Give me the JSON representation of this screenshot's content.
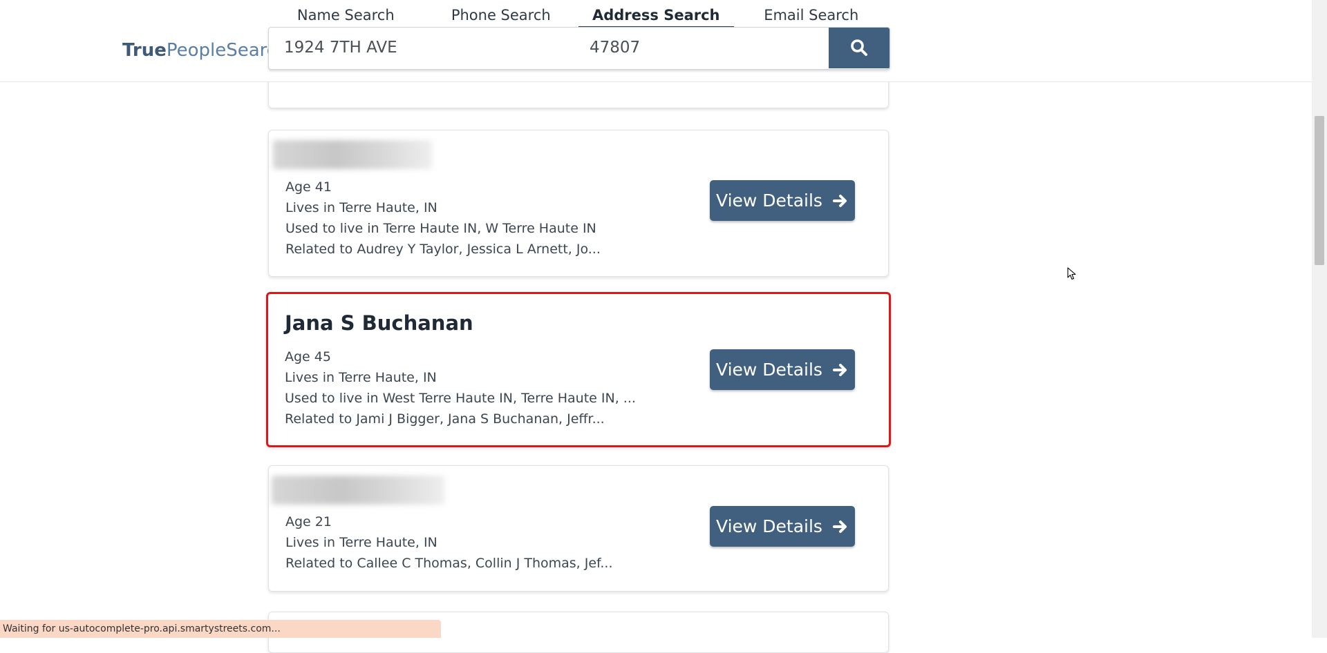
{
  "logo": {
    "bold": "True",
    "normal": "PeopleSearch"
  },
  "tabs": [
    {
      "label": "Name Search"
    },
    {
      "label": "Phone Search"
    },
    {
      "label": "Address Search"
    },
    {
      "label": "Email Search"
    }
  ],
  "search": {
    "address_value": "1924 7TH AVE",
    "zip_value": "47807",
    "button_icon": "search-icon"
  },
  "results": [
    {
      "name": "",
      "name_blurred": true,
      "age": "Age 41",
      "lives": "Lives in Terre Haute, IN",
      "used_to_live": "Used to live in Terre Haute IN, W Terre Haute IN",
      "related": "Related to Audrey Y Taylor, Jessica L Arnett, Jo...",
      "button_label": "View Details"
    },
    {
      "name": "Jana S Buchanan",
      "name_blurred": false,
      "age": "Age 45",
      "lives": "Lives in Terre Haute, IN",
      "used_to_live": "Used to live in West Terre Haute IN, Terre Haute IN, ...",
      "related": "Related to Jami J Bigger, Jana S Buchanan, Jeffr...",
      "button_label": "View Details",
      "highlight_color": "#e01515"
    },
    {
      "name": "",
      "name_blurred": true,
      "age": "Age 21",
      "lives": "Lives in Terre Haute, IN",
      "related": "Related to Callee C Thomas, Collin J Thomas, Jef...",
      "button_label": "View Details"
    }
  ],
  "status_bar": "Waiting for us-autocomplete-pro.api.smartystreets.com...",
  "colors": {
    "accent": "#41607f",
    "highlight": "#e01515",
    "status_bg": "#fbd8c6"
  }
}
